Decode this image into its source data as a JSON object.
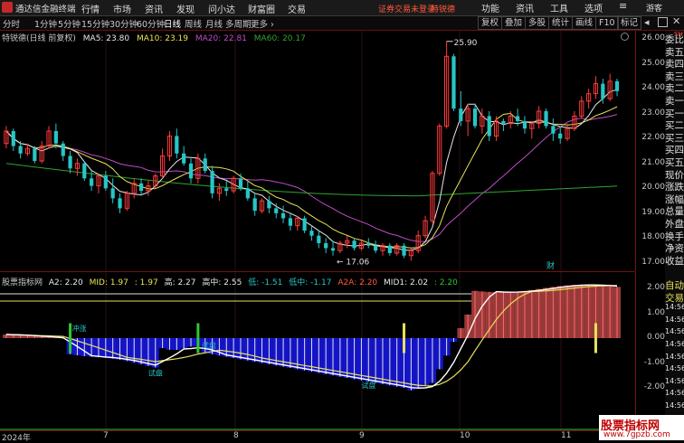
{
  "app": {
    "title": "通达信金融终端",
    "login_warning": "证券交易未登录",
    "stock_name": "特锐德",
    "guest": "游客"
  },
  "menu": [
    "行情",
    "市场",
    "资讯",
    "发现",
    "问小达",
    "财富圈",
    "交易"
  ],
  "right_menu": [
    "功能",
    "资讯",
    "工具",
    "选项"
  ],
  "periods": [
    "分时",
    "1分钟",
    "5分钟",
    "15分钟",
    "30分钟",
    "60分钟",
    "日线",
    "周线",
    "月线",
    "多周期",
    "更多 ›"
  ],
  "active_period": "日线",
  "toolbar": [
    "复权",
    "叠加",
    "多股",
    "统计",
    "画线",
    "F10",
    "标记"
  ],
  "main_legend": {
    "name": "特锐德(日线 前复权)",
    "ma5": "MA5: 23.80",
    "ma10": "MA10: 23.19",
    "ma20": "MA20: 22.81",
    "ma60": "MA60: 20.17"
  },
  "colors": {
    "up": "#ff3b3b",
    "down": "#27c6c6",
    "ma5": "#e8e8e8",
    "ma10": "#e8e25a",
    "ma20": "#c04cc8",
    "ma60": "#2fa52f"
  },
  "price_labels": {
    "high": "25.90",
    "low": "17.06",
    "fin_marker": "财"
  },
  "price_ticks": [
    "26.00",
    "25.00",
    "24.00",
    "23.00",
    "22.00",
    "21.00",
    "20.00",
    "19.00",
    "18.00",
    "17.00"
  ],
  "sub_legend": {
    "name": "股票指标网",
    "a2": "A2: 2.20",
    "mid": "MID: 1.97",
    "mid2": ": 1.97",
    "gao": "高: 2.27",
    "gaozhong": "高中: 2.55",
    "di": "低: -1.51",
    "dizhong": "低中: -1.17",
    "a2a": "A2A: 2.20",
    "mid1": "MID1: 2.02",
    "last": ": 2.20"
  },
  "sub_ticks": [
    "2.00",
    "1.00",
    "0.00",
    "-1.00",
    "-2.00"
  ],
  "sub_annotations": [
    "冲涨",
    "试盘",
    "试盘",
    "试盘"
  ],
  "date_ticks": [
    "2024年",
    "7",
    "8",
    "9",
    "10",
    "11"
  ],
  "side_panel": [
    "委比",
    "卖五",
    "卖四",
    "卖三",
    "卖二",
    "卖一",
    "买一",
    "买二",
    "买三",
    "买四",
    "买五",
    "现价",
    "涨跌",
    "涨幅",
    "总量",
    "外盘",
    "换手",
    "净资",
    "收益",
    "",
    "自动",
    "交易",
    "14:56",
    "14:56",
    "14:56",
    "14:56",
    "14:56",
    "14:56",
    "14:56",
    "14:56",
    "14:56",
    "14:56"
  ],
  "side_top_label": "SH",
  "watermark": {
    "line1": "股票指标网",
    "line2": "www.7gpzb.com"
  },
  "chart_data": {
    "type": "candlestick",
    "title": "特锐德(日线 前复权)",
    "ylim": [
      16.8,
      26.4
    ],
    "high_label": 25.9,
    "low_label": 17.06,
    "candles": [
      [
        21.8,
        22.5,
        21.6,
        22.3
      ],
      [
        22.3,
        22.4,
        21.5,
        21.7
      ],
      [
        21.7,
        21.9,
        21.2,
        21.4
      ],
      [
        21.4,
        21.8,
        21.3,
        21.6
      ],
      [
        21.6,
        21.7,
        21.0,
        21.1
      ],
      [
        21.1,
        21.9,
        21.0,
        21.7
      ],
      [
        21.7,
        22.5,
        21.6,
        22.3
      ],
      [
        22.3,
        22.6,
        21.6,
        21.8
      ],
      [
        21.8,
        21.9,
        21.1,
        21.3
      ],
      [
        21.3,
        21.5,
        20.6,
        20.8
      ],
      [
        20.8,
        21.2,
        20.5,
        21.0
      ],
      [
        21.0,
        21.1,
        20.3,
        20.4
      ],
      [
        20.4,
        20.7,
        19.9,
        20.1
      ],
      [
        20.1,
        20.6,
        19.8,
        20.5
      ],
      [
        20.5,
        20.7,
        19.9,
        20.0
      ],
      [
        20.0,
        20.4,
        19.4,
        19.6
      ],
      [
        19.6,
        19.8,
        19.0,
        19.2
      ],
      [
        19.2,
        19.9,
        19.1,
        19.8
      ],
      [
        19.8,
        20.4,
        19.6,
        20.2
      ],
      [
        20.2,
        20.4,
        19.7,
        19.9
      ],
      [
        19.9,
        20.3,
        19.7,
        20.1
      ],
      [
        20.1,
        20.6,
        20.0,
        20.5
      ],
      [
        20.5,
        21.6,
        20.4,
        21.3
      ],
      [
        21.3,
        22.3,
        21.1,
        22.1
      ],
      [
        22.1,
        22.4,
        21.2,
        21.4
      ],
      [
        21.4,
        21.7,
        20.9,
        21.0
      ],
      [
        21.0,
        21.2,
        20.2,
        20.4
      ],
      [
        20.4,
        21.4,
        20.2,
        21.2
      ],
      [
        21.2,
        21.4,
        20.6,
        20.7
      ],
      [
        20.7,
        20.9,
        19.6,
        19.8
      ],
      [
        19.8,
        20.2,
        19.5,
        20.0
      ],
      [
        20.0,
        20.3,
        19.7,
        19.9
      ],
      [
        19.9,
        20.5,
        19.8,
        20.4
      ],
      [
        20.4,
        20.6,
        19.9,
        20.0
      ],
      [
        20.0,
        20.3,
        19.5,
        19.6
      ],
      [
        19.6,
        19.8,
        18.9,
        19.1
      ],
      [
        19.1,
        19.6,
        19.0,
        19.5
      ],
      [
        19.5,
        19.7,
        19.0,
        19.2
      ],
      [
        19.2,
        19.4,
        18.8,
        19.0
      ],
      [
        19.0,
        19.3,
        18.6,
        18.8
      ],
      [
        18.8,
        19.0,
        18.3,
        18.5
      ],
      [
        18.5,
        18.9,
        18.3,
        18.8
      ],
      [
        18.8,
        18.9,
        18.2,
        18.3
      ],
      [
        18.3,
        18.5,
        17.9,
        18.1
      ],
      [
        18.1,
        18.3,
        17.6,
        17.8
      ],
      [
        17.8,
        18.0,
        17.4,
        17.6
      ],
      [
        17.6,
        17.9,
        17.3,
        17.5
      ],
      [
        17.5,
        17.9,
        17.4,
        17.8
      ],
      [
        17.8,
        18.1,
        17.6,
        17.9
      ],
      [
        17.9,
        18.0,
        17.5,
        17.6
      ],
      [
        17.6,
        17.9,
        17.5,
        17.8
      ],
      [
        17.8,
        18.0,
        17.6,
        17.7
      ],
      [
        17.7,
        17.9,
        17.4,
        17.5
      ],
      [
        17.5,
        17.8,
        17.3,
        17.7
      ],
      [
        17.7,
        17.8,
        17.3,
        17.4
      ],
      [
        17.4,
        17.8,
        17.3,
        17.7
      ],
      [
        17.7,
        17.8,
        17.2,
        17.3
      ],
      [
        17.3,
        17.6,
        17.1,
        17.5
      ],
      [
        17.5,
        18.3,
        17.4,
        18.1
      ],
      [
        18.1,
        18.9,
        18.0,
        18.7
      ],
      [
        18.7,
        20.7,
        18.6,
        20.6
      ],
      [
        20.6,
        22.6,
        20.5,
        22.5
      ],
      [
        22.5,
        25.9,
        22.4,
        25.3
      ],
      [
        25.3,
        25.4,
        23.1,
        23.2
      ],
      [
        23.2,
        23.9,
        22.5,
        22.7
      ],
      [
        22.7,
        23.4,
        22.1,
        23.2
      ],
      [
        23.2,
        23.4,
        22.4,
        22.5
      ],
      [
        22.5,
        23.2,
        22.2,
        22.9
      ],
      [
        22.9,
        23.1,
        21.9,
        22.1
      ],
      [
        22.1,
        22.9,
        21.9,
        22.7
      ],
      [
        22.7,
        22.8,
        22.3,
        22.6
      ],
      [
        22.6,
        23.1,
        22.4,
        22.9
      ],
      [
        22.9,
        23.2,
        22.5,
        22.7
      ],
      [
        22.7,
        22.9,
        22.2,
        22.4
      ],
      [
        22.4,
        22.7,
        22.0,
        22.6
      ],
      [
        22.6,
        23.3,
        22.4,
        23.1
      ],
      [
        23.1,
        23.2,
        22.4,
        22.5
      ],
      [
        22.5,
        22.8,
        21.9,
        22.2
      ],
      [
        22.2,
        22.5,
        21.8,
        22.0
      ],
      [
        22.0,
        22.6,
        21.9,
        22.4
      ],
      [
        22.4,
        23.1,
        22.3,
        22.9
      ],
      [
        22.9,
        23.7,
        22.8,
        23.5
      ],
      [
        23.5,
        24.0,
        23.2,
        23.8
      ],
      [
        23.8,
        24.5,
        23.6,
        24.2
      ],
      [
        24.2,
        24.4,
        23.4,
        23.6
      ],
      [
        23.6,
        24.6,
        23.5,
        24.3
      ],
      [
        24.3,
        24.4,
        23.7,
        23.9
      ]
    ]
  }
}
